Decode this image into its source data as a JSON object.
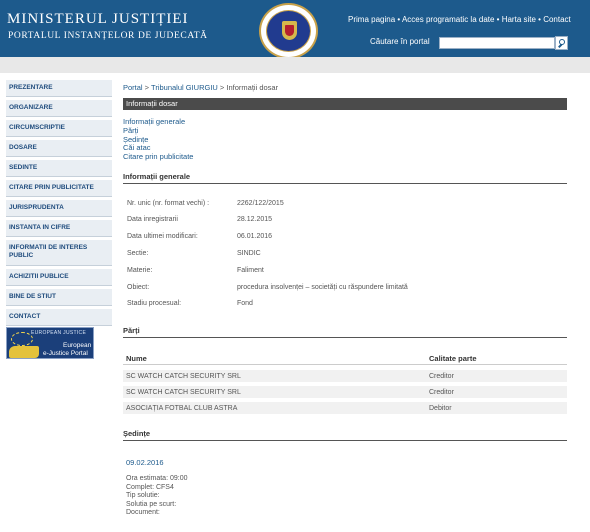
{
  "header": {
    "title": "MINISTERUL JUSTIȚIEI",
    "subtitle": "PORTALUL INSTANȚELOR DE JUDECATĂ",
    "top_links": [
      "Prima pagina",
      "Acces programatic la date",
      "Harta site",
      "Contact"
    ],
    "link_separator": " • ",
    "search_label": "Căutare în portal",
    "search_value": ""
  },
  "sidebar": {
    "items": [
      {
        "label": "PREZENTARE"
      },
      {
        "label": "ORGANIZARE"
      },
      {
        "label": "CIRCUMSCRIPTIE"
      },
      {
        "label": "DOSARE"
      },
      {
        "label": "SEDINTE"
      },
      {
        "label": "CITARE PRIN PUBLICITATE"
      },
      {
        "label": "JURISPRUDENTA"
      },
      {
        "label": "INSTANTA IN CIFRE"
      },
      {
        "label": "INFORMATII DE INTERES PUBLIC"
      },
      {
        "label": "ACHIZITII PUBLICE"
      },
      {
        "label": "BINE DE STIUT"
      },
      {
        "label": "CONTACT"
      }
    ],
    "banner": {
      "top": "EUROPEAN JUSTICE",
      "line1": "European",
      "line2": "e-Justice Portal"
    }
  },
  "breadcrumb": {
    "items": [
      "Portal",
      "Tribunalul GIURGIU",
      "Informații dosar"
    ],
    "separator": " > "
  },
  "page_title": "Informații dosar",
  "toc": [
    "Informații generale",
    "Părți",
    "Ședințe",
    "Căi atac",
    "Citare prin publicitate"
  ],
  "general": {
    "heading": "Informații generale",
    "rows": [
      {
        "label": "Nr. unic (nr. format vechi) :",
        "value": "2262/122/2015"
      },
      {
        "label": "Data inregistrarii",
        "value": "28.12.2015"
      },
      {
        "label": "Data ultimei modificari:",
        "value": "06.01.2016"
      },
      {
        "label": "Sectie:",
        "value": "SINDIC"
      },
      {
        "label": "Materie:",
        "value": "Faliment"
      },
      {
        "label": "Obiect:",
        "value": "procedura insolvenței – societăți cu răspundere limitată"
      },
      {
        "label": "Stadiu procesual:",
        "value": "Fond"
      }
    ]
  },
  "parti": {
    "heading": "Părți",
    "columns": [
      "Nume",
      "Calitate parte"
    ],
    "rows": [
      [
        "SC WATCH CATCH SECURITY SRL",
        "Creditor"
      ],
      [
        "SC WATCH CATCH SECURITY SRL",
        "Creditor"
      ],
      [
        "ASOCIAȚIA FOTBAL CLUB ASTRA",
        "Debitor"
      ]
    ]
  },
  "sedinte": {
    "heading": "Ședințe",
    "date": "09.02.2016",
    "details": [
      "Ora estimata: 09:00",
      "Complet: CFS4",
      "Tip solutie:",
      "Solutia pe scurt:",
      "Document:"
    ]
  }
}
